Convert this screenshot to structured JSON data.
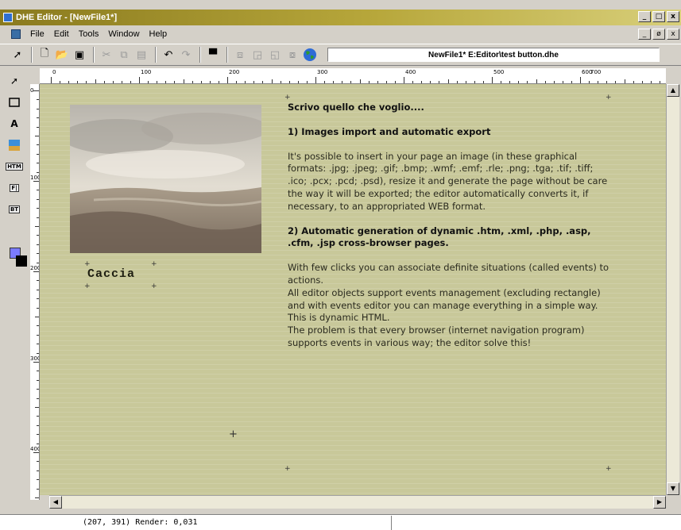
{
  "window": {
    "title": "DHE Editor - [NewFile1*]"
  },
  "menu": {
    "items": [
      "File",
      "Edit",
      "Tools",
      "Window",
      "Help"
    ]
  },
  "window_buttons": {
    "minimize": "_",
    "restore": "□",
    "close": "x",
    "mdi_restore": "ø"
  },
  "toolbar": {
    "buttons": [
      "pointer-icon",
      "new-icon",
      "open-icon",
      "save-icon",
      "cut-icon",
      "copy-icon",
      "paste-icon",
      "undo-icon",
      "redo-icon",
      "preview-icon",
      "align-icon",
      "bring-front-icon",
      "send-back-icon",
      "group-icon",
      "globe-icon"
    ],
    "path_text": "NewFile1* E:Editor\\test button.dhe"
  },
  "palette": {
    "tools": [
      "pointer-icon",
      "rectangle-icon",
      "text-icon",
      "image-icon",
      "htm-icon",
      "field-icon",
      "button-icon"
    ],
    "fg_color": "#7b7bff",
    "bg_color": "#000000"
  },
  "ruler": {
    "top_labels": [
      "0",
      "100",
      "200",
      "300",
      "400",
      "500",
      "600",
      "700"
    ],
    "left_labels": [
      "0",
      "100",
      "200",
      "300",
      "400"
    ]
  },
  "canvas": {
    "background": "#c8c89a",
    "caption": "Caccia",
    "text": {
      "intro": "Scrivo quello che voglio....",
      "h1": "1) Images import and automatic export",
      "p1": "It's possible to insert in your page an image (in these graphical formats: .jpg; .jpeg; .gif; .bmp; .wmf; .emf; .rle; .png; .tga; .tif; .tiff; .ico; .pcx; .pcd; .psd), resize it and generate the page without be care the way it will be exported; the editor automatically converts it, if necessary, to an appropriated WEB format.",
      "h2": "2) Automatic generation of dynamic .htm, .xml, .php, .asp, .cfm, .jsp cross-browser pages.",
      "p2a": "With few clicks you can associate definite situations (called events) to actions.",
      "p2b": "All editor objects support events management (excluding rectangle) and with events editor you can manage everything in a simple way. This is dynamic HTML.",
      "p2c": "The problem is that every browser (internet navigation program) supports events in various way; the editor solve this!"
    }
  },
  "status": {
    "text": "(207, 391) Render: 0,031"
  }
}
